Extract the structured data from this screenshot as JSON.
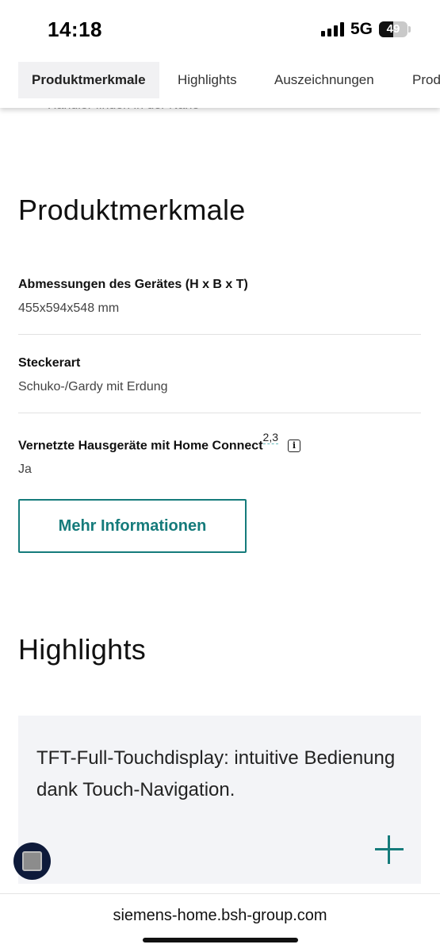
{
  "status_bar": {
    "time": "14:18",
    "network": "5G",
    "battery": "49",
    "battery_level": 0.49,
    "signal_icon": "signal-bars-icon"
  },
  "tabs": [
    {
      "label": "Produktmerkmale",
      "active": true
    },
    {
      "label": "Highlights",
      "active": false
    },
    {
      "label": "Auszeichnungen",
      "active": false
    },
    {
      "label": "Prod",
      "active": false
    }
  ],
  "ghost_text": "Händler finden in der Nähe",
  "product_features": {
    "title": "Produktmerkmale",
    "items": [
      {
        "label": "Abmessungen des Gerätes (H x B x T)",
        "value": "455x594x548 mm"
      },
      {
        "label": "Steckerart",
        "value": "Schuko-/Gardy mit Erdung"
      },
      {
        "label": "Vernetzte Hausgeräte mit Home Connect",
        "refs": "2,3",
        "value": "Ja"
      }
    ],
    "more_button": "Mehr Informationen"
  },
  "highlights": {
    "title": "Highlights",
    "card_text": "TFT-Full-Touchdisplay: intuitive Bedienung dank Touch-Navigation."
  },
  "browser": {
    "url": "siemens-home.bsh-group.com"
  },
  "colors": {
    "accent": "#157b7b",
    "card_bg": "#f3f4f7",
    "tab_active_bg": "#f1f1f3"
  }
}
